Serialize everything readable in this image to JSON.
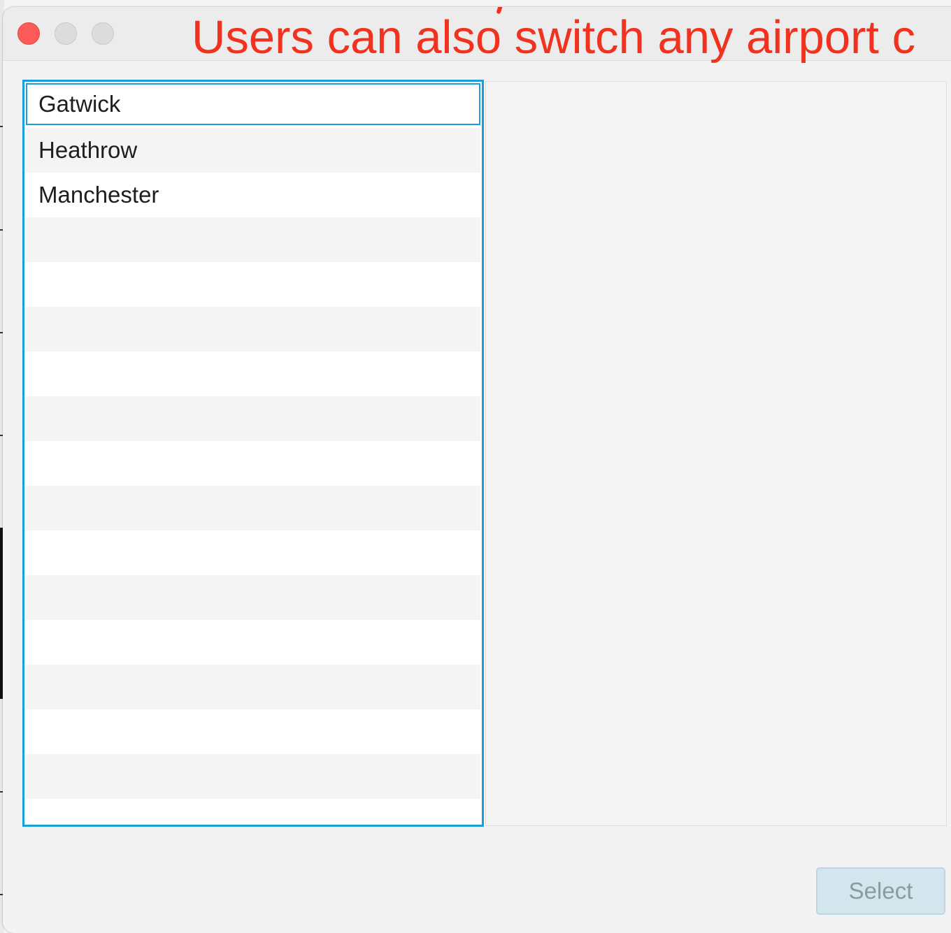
{
  "annotation": {
    "text": "Users can also switch any airport c",
    "color": "#f0321e"
  },
  "window": {
    "controls": [
      "close",
      "minimize",
      "maximize"
    ]
  },
  "airport_list": {
    "items": [
      {
        "label": "Gatwick",
        "selected": true
      },
      {
        "label": "Heathrow",
        "selected": false
      },
      {
        "label": "Manchester",
        "selected": false
      }
    ],
    "accent_color": "#1a9fd8"
  },
  "actions": {
    "select_label": "Select",
    "select_enabled": false
  }
}
